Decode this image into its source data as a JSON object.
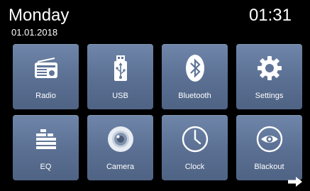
{
  "header": {
    "day": "Monday",
    "date": "01.01.2018",
    "time": "01:31"
  },
  "tiles": [
    {
      "label": "Radio",
      "icon": "radio-icon"
    },
    {
      "label": "USB",
      "icon": "usb-icon"
    },
    {
      "label": "Bluetooth",
      "icon": "bluetooth-icon"
    },
    {
      "label": "Settings",
      "icon": "gear-icon"
    },
    {
      "label": "EQ",
      "icon": "equalizer-icon"
    },
    {
      "label": "Camera",
      "icon": "camera-icon"
    },
    {
      "label": "Clock",
      "icon": "clock-icon"
    },
    {
      "label": "Blackout",
      "icon": "eye-icon"
    }
  ],
  "footer": {
    "next_icon": "arrow-right-icon"
  },
  "colors": {
    "background": "#000000",
    "tile": "#5f7598",
    "text": "#ffffff"
  }
}
